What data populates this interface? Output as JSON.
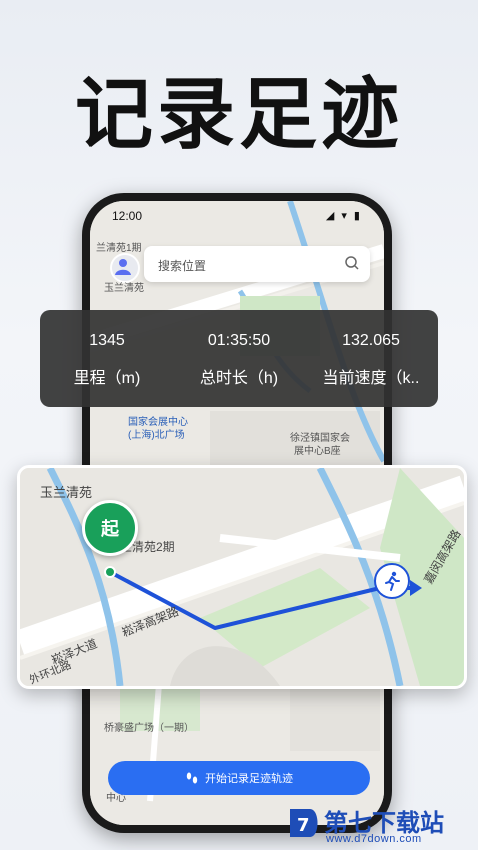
{
  "headline": "记录足迹",
  "status_bar": {
    "time": "12:00"
  },
  "search": {
    "placeholder": "搜索位置"
  },
  "map_labels": {
    "yulan_qingyuan_top": "兰清苑1期",
    "yulan_qingyuan_sub": "玉兰清苑",
    "guojia_huizhan": "国家会展中心",
    "guojia_huizhan_sub": "(上海)北广场",
    "xujing": "徐泾镇国家会",
    "xujing_sub": "展中心B座",
    "qiaohao": "桥豪盛广场（一期）",
    "zhongxin": "中心"
  },
  "stats": [
    {
      "value": "1345",
      "label": "里程（m)"
    },
    {
      "value": "01:35:50",
      "label": "总时长（h)"
    },
    {
      "value": "132.065",
      "label": "当前速度（k.."
    }
  ],
  "route_card": {
    "labels": {
      "yulan": "玉兰清苑",
      "yulan2": "兰清苑2期",
      "songze_gaojia": "崧泽高架路",
      "songze_dadao": "崧泽大道",
      "huanbeilu": "外环北路",
      "huqing_gaojia": "嘉闵高架路"
    },
    "start_marker": "起"
  },
  "start_button": {
    "label": "开始记录足迹轨迹"
  },
  "watermark": {
    "name": "第七下载站",
    "url": "www.d7down.com"
  },
  "colors": {
    "accent": "#2a6ef2",
    "route": "#1e52d8",
    "start": "#19a05a"
  }
}
